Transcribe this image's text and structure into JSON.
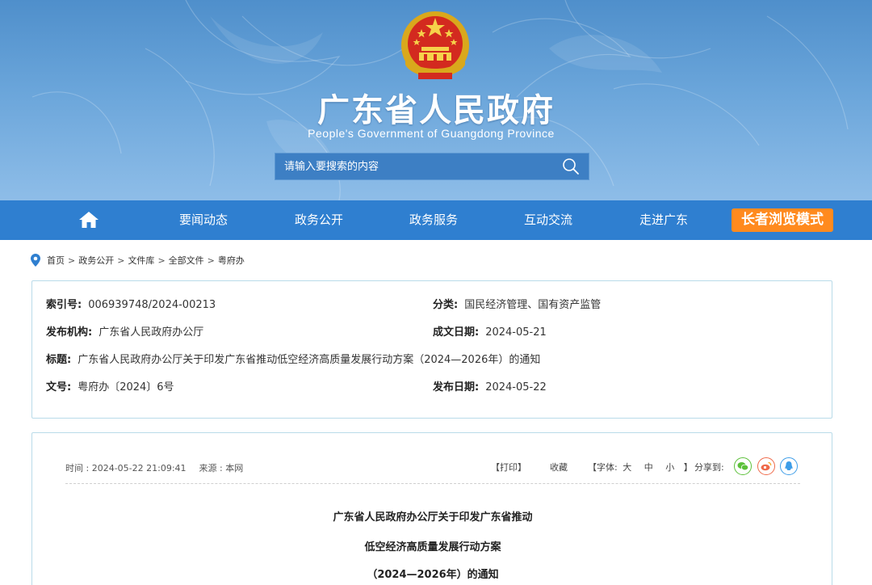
{
  "header": {
    "site_title": "广东省人民政府",
    "site_subtitle": "People's Government of Guangdong Province",
    "search_placeholder": "请输入要搜索的内容"
  },
  "nav": {
    "items": [
      "要闻动态",
      "政务公开",
      "政务服务",
      "互动交流",
      "走进广东"
    ],
    "elder_mode": "长者浏览模式"
  },
  "breadcrumb": [
    "首页",
    "政务公开",
    "文件库",
    "全部文件",
    "粤府办"
  ],
  "info": {
    "index_no_label": "索引号:",
    "index_no": "006939748/2024-00213",
    "category_label": "分类:",
    "category": "国民经济管理、国有资产监管",
    "publisher_label": "发布机构:",
    "publisher": "广东省人民政府办公厅",
    "written_date_label": "成文日期:",
    "written_date": "2024-05-21",
    "title_label": "标题:",
    "title": "广东省人民政府办公厅关于印发广东省推动低空经济高质量发展行动方案（2024—2026年）的通知",
    "doc_no_label": "文号:",
    "doc_no": "粤府办〔2024〕6号",
    "publish_date_label": "发布日期:",
    "publish_date": "2024-05-22"
  },
  "article": {
    "time": "时间 : 2024-05-22 21:09:41",
    "source": "来源 : 本网",
    "print": "【打印】",
    "favorite": "收藏",
    "font_size_open": "【字体:",
    "font_large": "大",
    "font_medium": "中",
    "font_small": "小",
    "font_size_close": "】",
    "share_label": "分享到:",
    "title_lines": [
      "广东省人民政府办公厅关于印发广东省推动",
      "低空经济高质量发展行动方案",
      "（2024—2026年）的通知"
    ]
  },
  "colors": {
    "nav_bg": "#2f7fd0",
    "elder_btn": "#ff8a1e",
    "panel_border": "#b9dbe9",
    "wechat": "#5cc03a",
    "weibo": "#ef6a4a",
    "qq": "#3d9de8"
  },
  "icons": {
    "home": "home-icon",
    "search": "search-icon",
    "location": "location-pin-icon",
    "wechat": "wechat-icon",
    "weibo": "weibo-icon",
    "qq": "qq-icon",
    "emblem": "national-emblem-icon"
  }
}
